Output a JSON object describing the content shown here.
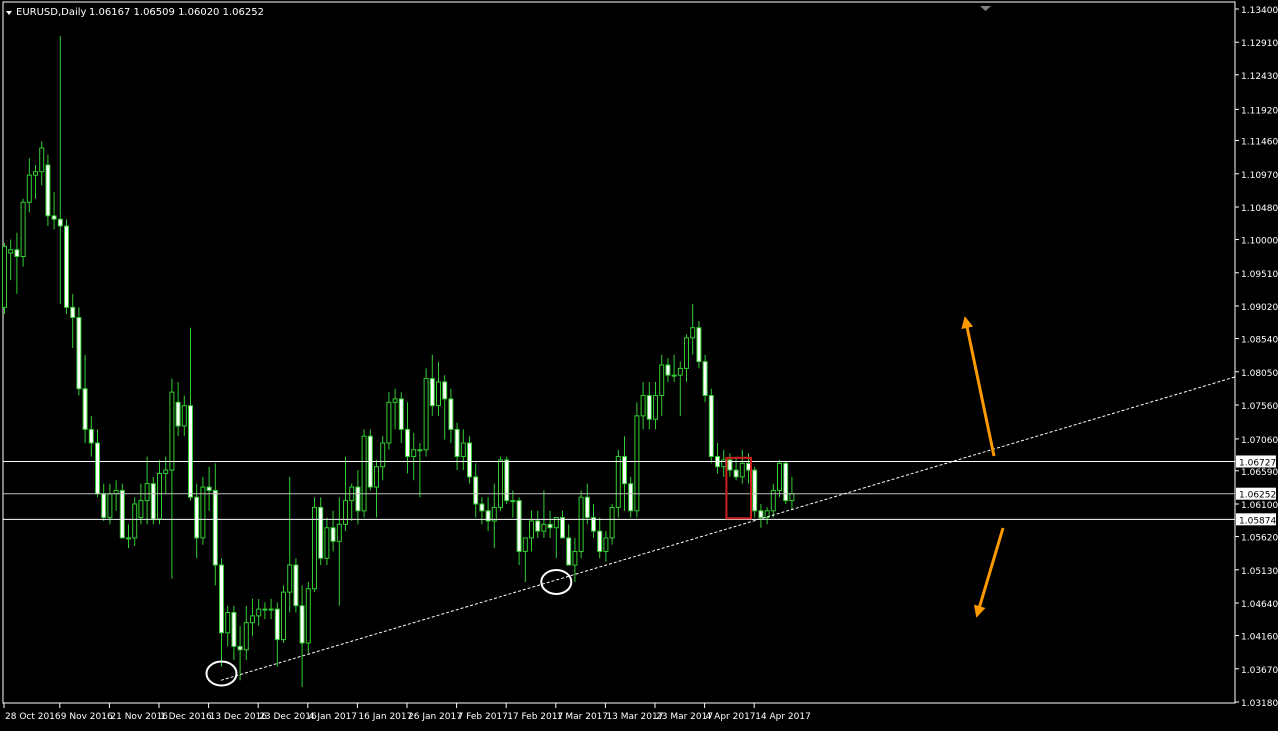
{
  "window": {
    "symbol_label": "EURUSD,Daily",
    "ohlc_label": "1.06167 1.06509 1.06020 1.06252"
  },
  "colors": {
    "background": "#000000",
    "candle": "#32cd32",
    "bull_fill": "#000000",
    "bear_fill": "#ffffff",
    "price_line": "#bfbfbf",
    "horizontal_line": "#ffffff",
    "trendline": "#ffffff",
    "arrow": "#ff9900",
    "highlight_box": "#cc2020",
    "marker_circle": "#ffffff"
  },
  "chart_data": {
    "type": "candlestick",
    "symbol": "EURUSD",
    "timeframe": "Daily",
    "ylim": [
      1.0318,
      1.134
    ],
    "y_ticks": [
      "1.13400",
      "1.12910",
      "1.12430",
      "1.11920",
      "1.11460",
      "1.10970",
      "1.10480",
      "1.10000",
      "1.09510",
      "1.09020",
      "1.08540",
      "1.08050",
      "1.07560",
      "1.07060",
      "1.06590",
      "1.06100",
      "1.05620",
      "1.05130",
      "1.04640",
      "1.04160",
      "1.03670",
      "1.03180"
    ],
    "x_ticks": [
      "28 Oct 2016",
      "9 Nov 2016",
      "21 Nov 2016",
      "1 Dec 2016",
      "13 Dec 2016",
      "23 Dec 2016",
      "4 Jan 2017",
      "16 Jan 2017",
      "26 Jan 2017",
      "7 Feb 2017",
      "17 Feb 2017",
      "1 Mar 2017",
      "13 Mar 2017",
      "23 Mar 2017",
      "4 Apr 2017",
      "14 Apr 2017"
    ],
    "current_price": {
      "value": 1.06252,
      "label": "1.06252"
    },
    "horizontal_lines": [
      {
        "value": 1.06727,
        "label": "1.06727"
      },
      {
        "value": 1.05874,
        "label": "1.05874"
      }
    ],
    "trendline": {
      "from": {
        "date": "15 Dec 2016",
        "price": 1.035
      },
      "extends_beyond_last_bar": true,
      "style": "dotted"
    },
    "annotations": [
      {
        "type": "circle",
        "date": "15 Dec 2016",
        "price": 1.036
      },
      {
        "type": "circle",
        "date": "1 Mar 2017",
        "price": 1.0495
      },
      {
        "type": "box",
        "from": "10 Apr 2017",
        "to": "13 Apr 2017",
        "price_range": [
          1.0589,
          1.0678
        ]
      },
      {
        "type": "arrow",
        "direction": "up"
      },
      {
        "type": "arrow",
        "direction": "down"
      }
    ],
    "candles": [
      {
        "d": "27 Oct",
        "o": 1.09,
        "h": 1.0995,
        "l": 1.089,
        "c": 1.099
      },
      {
        "d": "28 Oct",
        "o": 1.098,
        "h": 1.1,
        "l": 1.094,
        "c": 1.0985
      },
      {
        "d": "31 Oct",
        "o": 1.0985,
        "h": 1.101,
        "l": 1.092,
        "c": 1.0975
      },
      {
        "d": "1 Nov",
        "o": 1.0975,
        "h": 1.106,
        "l": 1.096,
        "c": 1.1055
      },
      {
        "d": "2 Nov",
        "o": 1.1055,
        "h": 1.112,
        "l": 1.104,
        "c": 1.1095
      },
      {
        "d": "3 Nov",
        "o": 1.1095,
        "h": 1.111,
        "l": 1.106,
        "c": 1.11
      },
      {
        "d": "4 Nov",
        "o": 1.11,
        "h": 1.1145,
        "l": 1.108,
        "c": 1.1135
      },
      {
        "d": "7 Nov",
        "o": 1.111,
        "h": 1.1125,
        "l": 1.102,
        "c": 1.1035
      },
      {
        "d": "8 Nov",
        "o": 1.1035,
        "h": 1.107,
        "l": 1.1015,
        "c": 1.103
      },
      {
        "d": "9 Nov",
        "o": 1.103,
        "h": 1.13,
        "l": 1.0905,
        "c": 1.102
      },
      {
        "d": "10 Nov",
        "o": 1.102,
        "h": 1.103,
        "l": 1.089,
        "c": 1.09
      },
      {
        "d": "11 Nov",
        "o": 1.09,
        "h": 1.092,
        "l": 1.084,
        "c": 1.0885
      },
      {
        "d": "14 Nov",
        "o": 1.0885,
        "h": 1.09,
        "l": 1.077,
        "c": 1.078
      },
      {
        "d": "15 Nov",
        "o": 1.078,
        "h": 1.083,
        "l": 1.07,
        "c": 1.072
      },
      {
        "d": "16 Nov",
        "o": 1.072,
        "h": 1.074,
        "l": 1.068,
        "c": 1.07
      },
      {
        "d": "17 Nov",
        "o": 1.07,
        "h": 1.072,
        "l": 1.062,
        "c": 1.0625
      },
      {
        "d": "18 Nov",
        "o": 1.0625,
        "h": 1.064,
        "l": 1.0585,
        "c": 1.059
      },
      {
        "d": "21 Nov",
        "o": 1.059,
        "h": 1.064,
        "l": 1.058,
        "c": 1.0625
      },
      {
        "d": "22 Nov",
        "o": 1.0625,
        "h": 1.0645,
        "l": 1.06,
        "c": 1.063
      },
      {
        "d": "23 Nov",
        "o": 1.063,
        "h": 1.064,
        "l": 1.056,
        "c": 1.056
      },
      {
        "d": "24 Nov",
        "o": 1.056,
        "h": 1.058,
        "l": 1.0545,
        "c": 1.056
      },
      {
        "d": "25 Nov",
        "o": 1.056,
        "h": 1.062,
        "l": 1.0548,
        "c": 1.061
      },
      {
        "d": "28 Nov",
        "o": 1.059,
        "h": 1.064,
        "l": 1.058,
        "c": 1.0615
      },
      {
        "d": "29 Nov",
        "o": 1.0615,
        "h": 1.068,
        "l": 1.058,
        "c": 1.064
      },
      {
        "d": "30 Nov",
        "o": 1.064,
        "h": 1.065,
        "l": 1.058,
        "c": 1.0588
      },
      {
        "d": "1 Dec",
        "o": 1.0588,
        "h": 1.0675,
        "l": 1.058,
        "c": 1.0655
      },
      {
        "d": "2 Dec",
        "o": 1.0655,
        "h": 1.068,
        "l": 1.0625,
        "c": 1.066
      },
      {
        "d": "5 Dec",
        "o": 1.066,
        "h": 1.0795,
        "l": 1.05,
        "c": 1.0775
      },
      {
        "d": "6 Dec",
        "o": 1.076,
        "h": 1.079,
        "l": 1.071,
        "c": 1.0725
      },
      {
        "d": "7 Dec",
        "o": 1.0725,
        "h": 1.077,
        "l": 1.071,
        "c": 1.0755
      },
      {
        "d": "8 Dec",
        "o": 1.0755,
        "h": 1.087,
        "l": 1.0615,
        "c": 1.062
      },
      {
        "d": "9 Dec",
        "o": 1.062,
        "h": 1.064,
        "l": 1.053,
        "c": 1.056
      },
      {
        "d": "12 Dec",
        "o": 1.056,
        "h": 1.065,
        "l": 1.055,
        "c": 1.0635
      },
      {
        "d": "13 Dec",
        "o": 1.0635,
        "h": 1.0665,
        "l": 1.06,
        "c": 1.063
      },
      {
        "d": "14 Dec",
        "o": 1.063,
        "h": 1.067,
        "l": 1.049,
        "c": 1.052
      },
      {
        "d": "15 Dec",
        "o": 1.052,
        "h": 1.053,
        "l": 1.037,
        "c": 1.042
      },
      {
        "d": "16 Dec",
        "o": 1.042,
        "h": 1.046,
        "l": 1.04,
        "c": 1.045
      },
      {
        "d": "19 Dec",
        "o": 1.045,
        "h": 1.046,
        "l": 1.038,
        "c": 1.04
      },
      {
        "d": "20 Dec",
        "o": 1.04,
        "h": 1.043,
        "l": 1.035,
        "c": 1.0395
      },
      {
        "d": "21 Dec",
        "o": 1.0395,
        "h": 1.046,
        "l": 1.038,
        "c": 1.0435
      },
      {
        "d": "22 Dec",
        "o": 1.0435,
        "h": 1.047,
        "l": 1.0415,
        "c": 1.0445
      },
      {
        "d": "23 Dec",
        "o": 1.0445,
        "h": 1.047,
        "l": 1.043,
        "c": 1.0455
      },
      {
        "d": "26 Dec",
        "o": 1.0455,
        "h": 1.0465,
        "l": 1.044,
        "c": 1.0455
      },
      {
        "d": "27 Dec",
        "o": 1.0455,
        "h": 1.047,
        "l": 1.044,
        "c": 1.0455
      },
      {
        "d": "28 Dec",
        "o": 1.0455,
        "h": 1.0465,
        "l": 1.037,
        "c": 1.041
      },
      {
        "d": "29 Dec",
        "o": 1.041,
        "h": 1.049,
        "l": 1.0405,
        "c": 1.048
      },
      {
        "d": "30 Dec",
        "o": 1.048,
        "h": 1.065,
        "l": 1.045,
        "c": 1.052
      },
      {
        "d": "2 Jan",
        "o": 1.052,
        "h": 1.053,
        "l": 1.045,
        "c": 1.046
      },
      {
        "d": "3 Jan",
        "o": 1.046,
        "h": 1.049,
        "l": 1.034,
        "c": 1.0405
      },
      {
        "d": "4 Jan",
        "o": 1.0405,
        "h": 1.0495,
        "l": 1.039,
        "c": 1.0485
      },
      {
        "d": "5 Jan",
        "o": 1.0485,
        "h": 1.062,
        "l": 1.048,
        "c": 1.0605
      },
      {
        "d": "6 Jan",
        "o": 1.0605,
        "h": 1.062,
        "l": 1.052,
        "c": 1.053
      },
      {
        "d": "9 Jan",
        "o": 1.053,
        "h": 1.059,
        "l": 1.052,
        "c": 1.0575
      },
      {
        "d": "10 Jan",
        "o": 1.0575,
        "h": 1.06,
        "l": 1.054,
        "c": 1.0555
      },
      {
        "d": "11 Jan",
        "o": 1.0555,
        "h": 1.062,
        "l": 1.046,
        "c": 1.058
      },
      {
        "d": "12 Jan",
        "o": 1.058,
        "h": 1.068,
        "l": 1.057,
        "c": 1.0615
      },
      {
        "d": "13 Jan",
        "o": 1.0615,
        "h": 1.064,
        "l": 1.0585,
        "c": 1.0635
      },
      {
        "d": "16 Jan",
        "o": 1.0635,
        "h": 1.066,
        "l": 1.058,
        "c": 1.06
      },
      {
        "d": "17 Jan",
        "o": 1.06,
        "h": 1.072,
        "l": 1.059,
        "c": 1.071
      },
      {
        "d": "18 Jan",
        "o": 1.071,
        "h": 1.072,
        "l": 1.063,
        "c": 1.0635
      },
      {
        "d": "19 Jan",
        "o": 1.0635,
        "h": 1.0675,
        "l": 1.059,
        "c": 1.0665
      },
      {
        "d": "20 Jan",
        "o": 1.0665,
        "h": 1.071,
        "l": 1.0645,
        "c": 1.07
      },
      {
        "d": "23 Jan",
        "o": 1.07,
        "h": 1.0775,
        "l": 1.069,
        "c": 1.076
      },
      {
        "d": "24 Jan",
        "o": 1.076,
        "h": 1.078,
        "l": 1.072,
        "c": 1.0765
      },
      {
        "d": "25 Jan",
        "o": 1.0765,
        "h": 1.0775,
        "l": 1.07,
        "c": 1.072
      },
      {
        "d": "26 Jan",
        "o": 1.072,
        "h": 1.076,
        "l": 1.0655,
        "c": 1.068
      },
      {
        "d": "27 Jan",
        "o": 1.068,
        "h": 1.0715,
        "l": 1.0645,
        "c": 1.069
      },
      {
        "d": "30 Jan",
        "o": 1.069,
        "h": 1.07,
        "l": 1.062,
        "c": 1.069
      },
      {
        "d": "31 Jan",
        "o": 1.069,
        "h": 1.081,
        "l": 1.068,
        "c": 1.0795
      },
      {
        "d": "1 Feb",
        "o": 1.0795,
        "h": 1.083,
        "l": 1.074,
        "c": 1.0755
      },
      {
        "d": "2 Feb",
        "o": 1.0755,
        "h": 1.082,
        "l": 1.074,
        "c": 1.079
      },
      {
        "d": "3 Feb",
        "o": 1.079,
        "h": 1.08,
        "l": 1.0705,
        "c": 1.0765
      },
      {
        "d": "6 Feb",
        "o": 1.0765,
        "h": 1.078,
        "l": 1.07,
        "c": 1.072
      },
      {
        "d": "7 Feb",
        "o": 1.072,
        "h": 1.073,
        "l": 1.066,
        "c": 1.068
      },
      {
        "d": "8 Feb",
        "o": 1.068,
        "h": 1.072,
        "l": 1.066,
        "c": 1.07
      },
      {
        "d": "9 Feb",
        "o": 1.07,
        "h": 1.071,
        "l": 1.064,
        "c": 1.065
      },
      {
        "d": "10 Feb",
        "o": 1.065,
        "h": 1.067,
        "l": 1.059,
        "c": 1.061
      },
      {
        "d": "13 Feb",
        "o": 1.061,
        "h": 1.062,
        "l": 1.058,
        "c": 1.06
      },
      {
        "d": "14 Feb",
        "o": 1.06,
        "h": 1.062,
        "l": 1.057,
        "c": 1.0585
      },
      {
        "d": "15 Feb",
        "o": 1.0585,
        "h": 1.064,
        "l": 1.0545,
        "c": 1.0605
      },
      {
        "d": "16 Feb",
        "o": 1.0605,
        "h": 1.068,
        "l": 1.06,
        "c": 1.0675
      },
      {
        "d": "17 Feb",
        "o": 1.0675,
        "h": 1.068,
        "l": 1.061,
        "c": 1.0615
      },
      {
        "d": "20 Feb",
        "o": 1.0615,
        "h": 1.063,
        "l": 1.059,
        "c": 1.0615
      },
      {
        "d": "21 Feb",
        "o": 1.0615,
        "h": 1.062,
        "l": 1.052,
        "c": 1.054
      },
      {
        "d": "22 Feb",
        "o": 1.054,
        "h": 1.056,
        "l": 1.0495,
        "c": 1.056
      },
      {
        "d": "23 Feb",
        "o": 1.056,
        "h": 1.06,
        "l": 1.054,
        "c": 1.0585
      },
      {
        "d": "24 Feb",
        "o": 1.0585,
        "h": 1.06,
        "l": 1.056,
        "c": 1.057
      },
      {
        "d": "27 Feb",
        "o": 1.057,
        "h": 1.063,
        "l": 1.056,
        "c": 1.058
      },
      {
        "d": "28 Feb",
        "o": 1.058,
        "h": 1.06,
        "l": 1.056,
        "c": 1.0575
      },
      {
        "d": "1 Mar",
        "o": 1.0575,
        "h": 1.059,
        "l": 1.053,
        "c": 1.059
      },
      {
        "d": "2 Mar",
        "o": 1.059,
        "h": 1.06,
        "l": 1.056,
        "c": 1.056
      },
      {
        "d": "3 Mar",
        "o": 1.056,
        "h": 1.058,
        "l": 1.052,
        "c": 1.052
      },
      {
        "d": "6 Mar",
        "o": 1.052,
        "h": 1.056,
        "l": 1.0495,
        "c": 1.054
      },
      {
        "d": "7 Mar",
        "o": 1.054,
        "h": 1.063,
        "l": 1.053,
        "c": 1.062
      },
      {
        "d": "8 Mar",
        "o": 1.062,
        "h": 1.064,
        "l": 1.058,
        "c": 1.059
      },
      {
        "d": "9 Mar",
        "o": 1.059,
        "h": 1.061,
        "l": 1.056,
        "c": 1.057
      },
      {
        "d": "10 Mar",
        "o": 1.057,
        "h": 1.059,
        "l": 1.053,
        "c": 1.054
      },
      {
        "d": "13 Mar",
        "o": 1.054,
        "h": 1.057,
        "l": 1.0525,
        "c": 1.056
      },
      {
        "d": "14 Mar",
        "o": 1.056,
        "h": 1.061,
        "l": 1.055,
        "c": 1.0605
      },
      {
        "d": "15 Mar",
        "o": 1.0605,
        "h": 1.069,
        "l": 1.059,
        "c": 1.068
      },
      {
        "d": "16 Mar",
        "o": 1.068,
        "h": 1.071,
        "l": 1.06,
        "c": 1.064
      },
      {
        "d": "17 Mar",
        "o": 1.064,
        "h": 1.065,
        "l": 1.059,
        "c": 1.06
      },
      {
        "d": "20 Mar",
        "o": 1.06,
        "h": 1.076,
        "l": 1.059,
        "c": 1.074
      },
      {
        "d": "21 Mar",
        "o": 1.074,
        "h": 1.079,
        "l": 1.072,
        "c": 1.077
      },
      {
        "d": "22 Mar",
        "o": 1.077,
        "h": 1.079,
        "l": 1.072,
        "c": 1.0735
      },
      {
        "d": "23 Mar",
        "o": 1.0735,
        "h": 1.079,
        "l": 1.072,
        "c": 1.077
      },
      {
        "d": "24 Mar",
        "o": 1.077,
        "h": 1.083,
        "l": 1.074,
        "c": 1.0815
      },
      {
        "d": "27 Mar",
        "o": 1.0815,
        "h": 1.0825,
        "l": 1.079,
        "c": 1.08
      },
      {
        "d": "28 Mar",
        "o": 1.08,
        "h": 1.083,
        "l": 1.079,
        "c": 1.08
      },
      {
        "d": "29 Mar",
        "o": 1.08,
        "h": 1.082,
        "l": 1.074,
        "c": 1.081
      },
      {
        "d": "30 Mar",
        "o": 1.081,
        "h": 1.086,
        "l": 1.079,
        "c": 1.0855
      },
      {
        "d": "31 Mar",
        "o": 1.0855,
        "h": 1.0905,
        "l": 1.083,
        "c": 1.087
      },
      {
        "d": "3 Apr",
        "o": 1.087,
        "h": 1.088,
        "l": 1.081,
        "c": 1.082
      },
      {
        "d": "4 Apr",
        "o": 1.082,
        "h": 1.083,
        "l": 1.076,
        "c": 1.077
      },
      {
        "d": "5 Apr",
        "o": 1.077,
        "h": 1.078,
        "l": 1.067,
        "c": 1.068
      },
      {
        "d": "6 Apr",
        "o": 1.068,
        "h": 1.07,
        "l": 1.0655,
        "c": 1.0665
      },
      {
        "d": "7 Apr",
        "o": 1.0665,
        "h": 1.069,
        "l": 1.065,
        "c": 1.0675
      },
      {
        "d": "10 Apr",
        "o": 1.0675,
        "h": 1.0685,
        "l": 1.065,
        "c": 1.066
      },
      {
        "d": "11 Apr",
        "o": 1.066,
        "h": 1.068,
        "l": 1.0645,
        "c": 1.065
      },
      {
        "d": "12 Apr",
        "o": 1.065,
        "h": 1.069,
        "l": 1.064,
        "c": 1.067
      },
      {
        "d": "13 Apr",
        "o": 1.067,
        "h": 1.0685,
        "l": 1.064,
        "c": 1.066
      },
      {
        "d": "14 Apr",
        "o": 1.066,
        "h": 1.0665,
        "l": 1.059,
        "c": 1.06
      },
      {
        "d": "17 Apr",
        "o": 1.06,
        "h": 1.061,
        "l": 1.0575,
        "c": 1.059
      },
      {
        "d": "18 Apr",
        "o": 1.059,
        "h": 1.0605,
        "l": 1.058,
        "c": 1.06
      },
      {
        "d": "19 Apr",
        "o": 1.06,
        "h": 1.064,
        "l": 1.059,
        "c": 1.063
      },
      {
        "d": "20 Apr",
        "o": 1.063,
        "h": 1.0675,
        "l": 1.062,
        "c": 1.067
      },
      {
        "d": "21 Apr",
        "o": 1.067,
        "h": 1.0672,
        "l": 1.061,
        "c": 1.0615
      },
      {
        "d": "24 Apr",
        "o": 1.0615,
        "h": 1.065,
        "l": 1.0602,
        "c": 1.0625
      }
    ]
  }
}
